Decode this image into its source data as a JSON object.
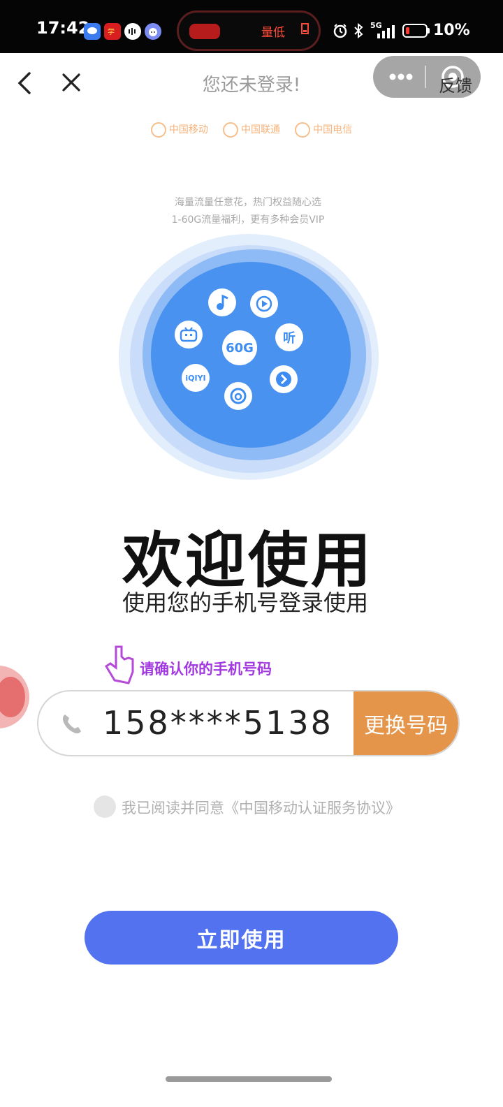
{
  "status_bar": {
    "time": "17:42",
    "pill_text": "量低",
    "network": "5G",
    "battery": "10%",
    "icons": [
      "message-icon",
      "app-icon",
      "voice-icon",
      "face-icon",
      "alarm-icon",
      "bluetooth-icon",
      "signal-icon",
      "battery-icon"
    ]
  },
  "nav": {
    "title": "您还未登录!",
    "feedback": "反馈",
    "more_icon": "ellipsis-icon",
    "target_icon": "target-icon"
  },
  "banner": {
    "carriers": [
      "中国移动",
      "中国联通",
      "中国电信"
    ],
    "tagline_1": "海量流量任意花，热门权益随心选",
    "tagline_2": "1-60G流量福利，更有多种会员VIP",
    "center_label": "60G",
    "iqiyi_label": "iQIYI",
    "ting_label": "听",
    "colors": {
      "primary": "#3d8cf2",
      "light": "#a9cdfa"
    }
  },
  "welcome": {
    "title": "欢迎使用",
    "subtitle": "使用您的手机号登录使用"
  },
  "phone": {
    "hint": "请确认你的手机号码",
    "number": "158****5138",
    "change_label": "更换号码"
  },
  "agreement": {
    "text": "我已阅读并同意《中国移动认证服务协议》"
  },
  "cta": {
    "label": "立即使用",
    "color": "#5272ef"
  }
}
